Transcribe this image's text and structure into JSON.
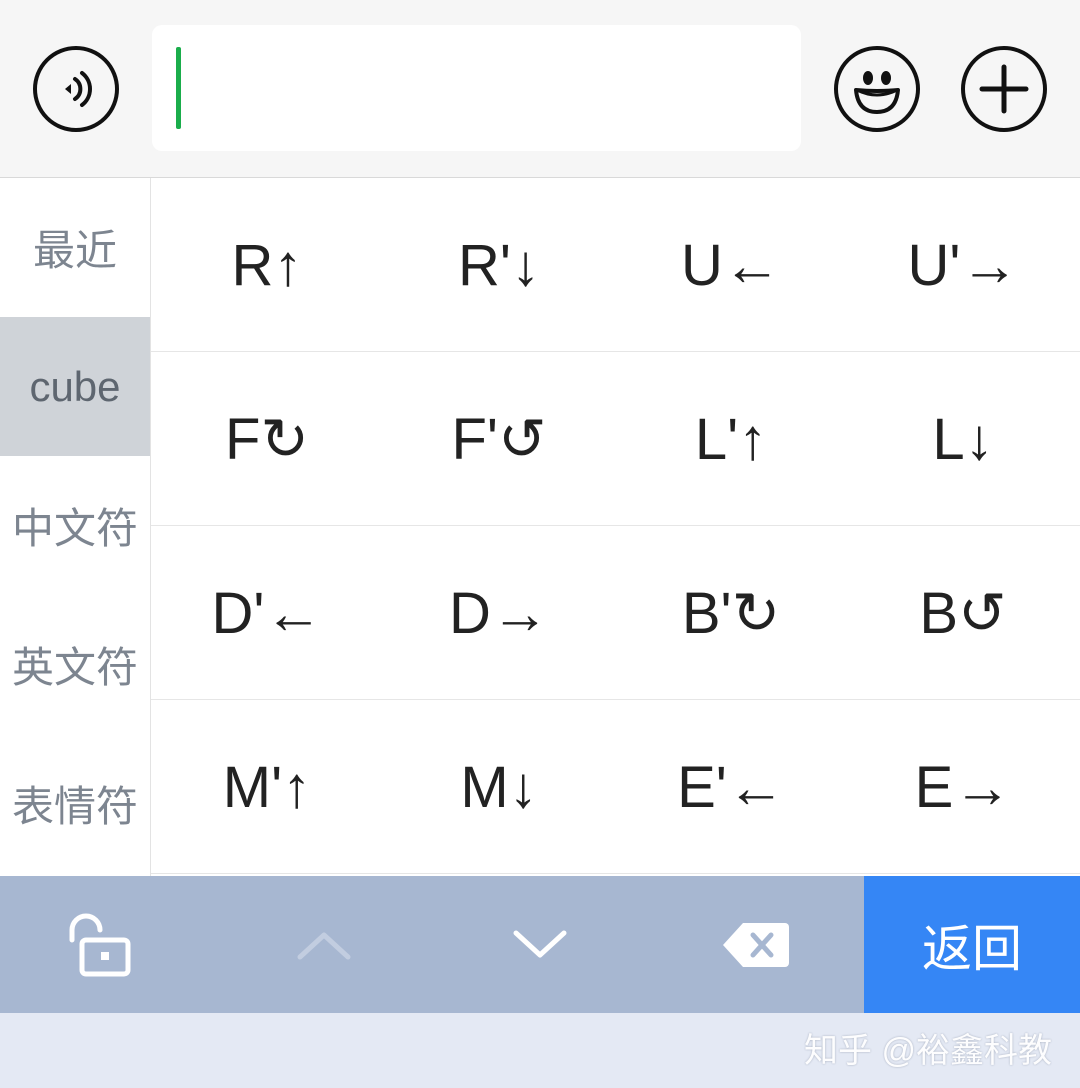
{
  "input": {
    "value": ""
  },
  "categories": [
    {
      "label": "最近"
    },
    {
      "label": "cube"
    },
    {
      "label": "中文符"
    },
    {
      "label": "英文符"
    },
    {
      "label": "表情符"
    }
  ],
  "selected_category": "cube",
  "symbols": [
    [
      "R↑",
      "R'↓",
      "U←",
      "U'→"
    ],
    [
      "F↻",
      "F'↺",
      "L'↑",
      "L↓"
    ],
    [
      "D'←",
      "D→",
      "B'↻",
      "B↺"
    ],
    [
      "M'↑",
      "M↓",
      "E'←",
      "E→"
    ]
  ],
  "bottom_bar": {
    "icons": [
      "unlock-icon",
      "chevron-up-icon",
      "chevron-down-icon",
      "backspace-icon"
    ],
    "return_label": "返回"
  },
  "watermark": "知乎 @裕鑫科教",
  "colors": {
    "caret": "#1aad4b",
    "return_button": "#3586f5",
    "bottom_bar": "#a7b7d1",
    "selected_category": "#cfd3d8"
  }
}
